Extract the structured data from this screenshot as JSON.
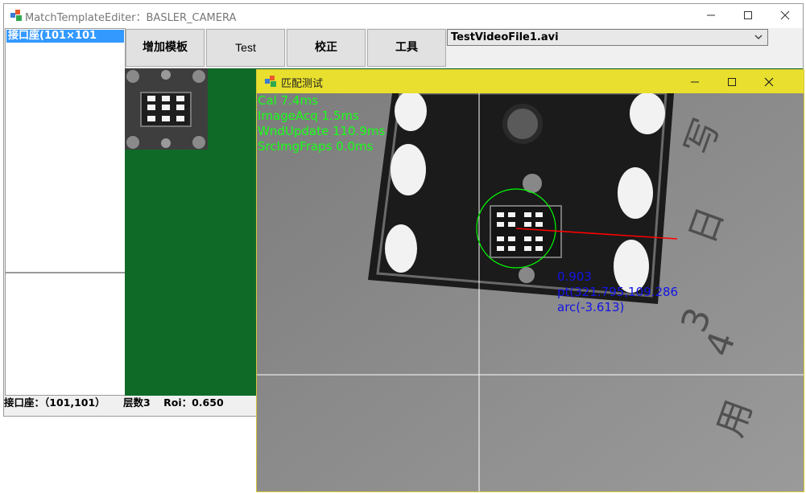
{
  "main_window": {
    "title": "MatchTemplateEditer：BASLER_CAMERA",
    "controls": {
      "minimize": "minimize",
      "maximize": "maximize",
      "close": "close"
    }
  },
  "template_list": {
    "items": [
      {
        "label": "接口座(101×101"
      }
    ]
  },
  "toolbar": {
    "add_template_label": "增加模板",
    "test_label": "Test",
    "calibrate_label": "校正",
    "tools_label": "工具"
  },
  "video_source": {
    "selected": "TestVideoFile1.avi"
  },
  "statusbar": {
    "connector": "接口座：（101,101）",
    "layers": "层数3",
    "roi": "Roi：0.650"
  },
  "dialog": {
    "title": "匹配测试",
    "stats": [
      "Cal 7.4ms",
      "ImageAcq 1.5ms",
      "WndUpdate 110.9ms",
      "SrcImgFraps 0.0ms"
    ],
    "result": {
      "score": "0.903",
      "pt": "pt(321.795,109.286",
      "arc": "arc(-3.613)"
    },
    "overlay_colors": {
      "stats": "#18ff18",
      "result": "#1414e6",
      "circle": "#00ff00",
      "direction_line": "#ff0000",
      "crosshair": "#ffffff"
    }
  },
  "colors": {
    "selection": "#3399ff",
    "canvas": "#0f6a27",
    "dialog_title": "#e9df2e"
  }
}
